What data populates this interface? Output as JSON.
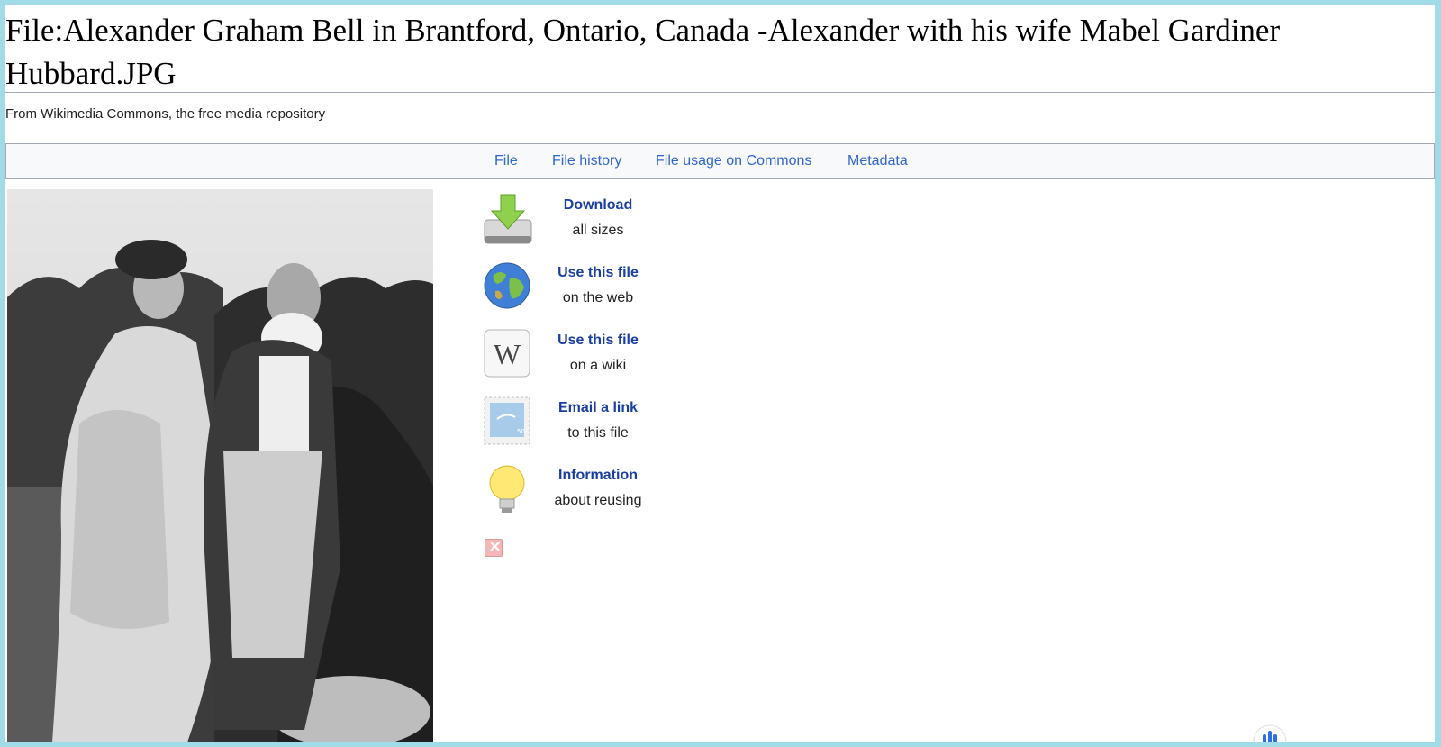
{
  "page": {
    "title": "File:Alexander Graham Bell in Brantford, Ontario, Canada -Alexander with his wife Mabel Gardiner Hubbard.JPG",
    "subtitle": "From Wikimedia Commons, the free media repository"
  },
  "tabs": [
    {
      "label": "File"
    },
    {
      "label": "File history"
    },
    {
      "label": "File usage on Commons"
    },
    {
      "label": "Metadata"
    }
  ],
  "actions": [
    {
      "title": "Download",
      "subtitle": "all sizes",
      "icon": "download-icon"
    },
    {
      "title": "Use this file",
      "subtitle": "on the web",
      "icon": "globe-icon"
    },
    {
      "title": "Use this file",
      "subtitle": "on a wiki",
      "icon": "wikipedia-icon"
    },
    {
      "title": "Email a link",
      "subtitle": "to this file",
      "icon": "stamp-icon"
    },
    {
      "title": "Information",
      "subtitle": "about reusing",
      "icon": "lightbulb-icon"
    }
  ],
  "colors": {
    "frame": "#a2dbe8",
    "link": "#3366cc",
    "action_link": "#1a3fa0",
    "tabbar_bg": "#f8f9fa"
  }
}
